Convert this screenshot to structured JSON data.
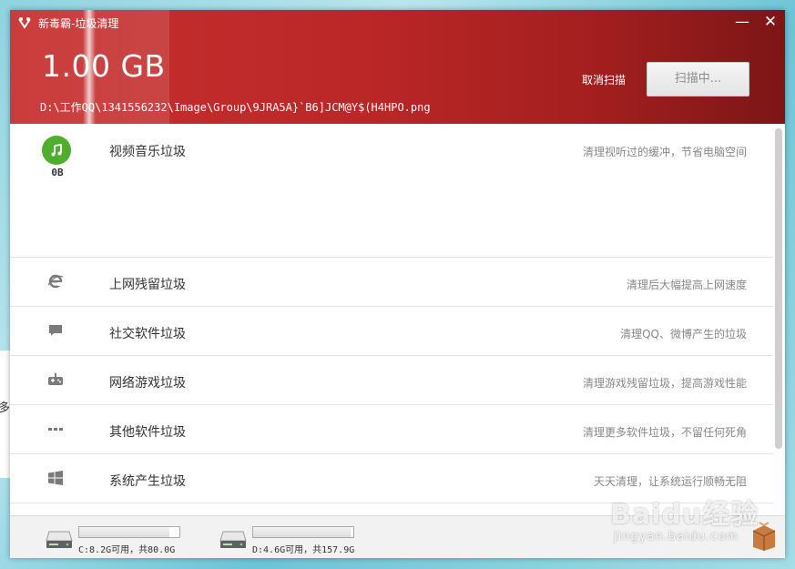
{
  "window": {
    "title": "新毒霸-垃圾清理",
    "minimize": "—",
    "close": "✕"
  },
  "scan": {
    "size": "1.00 GB",
    "path": "D:\\工作QQ\\1341556232\\Image\\Group\\9JRA5A}`B6]JCM@Y$(H4HPO.png",
    "cancel_label": "取消扫描",
    "scan_button_label": "扫描中..."
  },
  "categories": [
    {
      "label": "视频音乐垃圾",
      "desc": "清理视听过的缓冲，节省电脑空间",
      "size": "0B",
      "icon": "music-icon"
    },
    {
      "label": "上网残留垃圾",
      "desc": "清理后大幅提高上网速度",
      "icon": "ie-icon"
    },
    {
      "label": "社交软件垃圾",
      "desc": "清理QQ、微博产生的垃圾",
      "icon": "chat-icon"
    },
    {
      "label": "网络游戏垃圾",
      "desc": "清理游戏残留垃圾，提高游戏性能",
      "icon": "gamepad-icon"
    },
    {
      "label": "其他软件垃圾",
      "desc": "清理更多软件垃圾，不留任何死角",
      "icon": "more-icon"
    },
    {
      "label": "系统产生垃圾",
      "desc": "天天清理，让系统运行顺畅无阻",
      "icon": "windows-icon"
    }
  ],
  "drives": [
    {
      "text": "C:8.2G可用，共80.0G",
      "used_fraction": 0.9
    },
    {
      "text": "D:4.6G可用，共157.9G",
      "used_fraction": 0.97
    }
  ],
  "background": {
    "partial_text": "多"
  },
  "watermark": {
    "brand": "Baidu经验",
    "url": "jingyan.baidu.com"
  },
  "colors": {
    "header_red": "#c7302f",
    "music_green": "#4fae2e"
  }
}
